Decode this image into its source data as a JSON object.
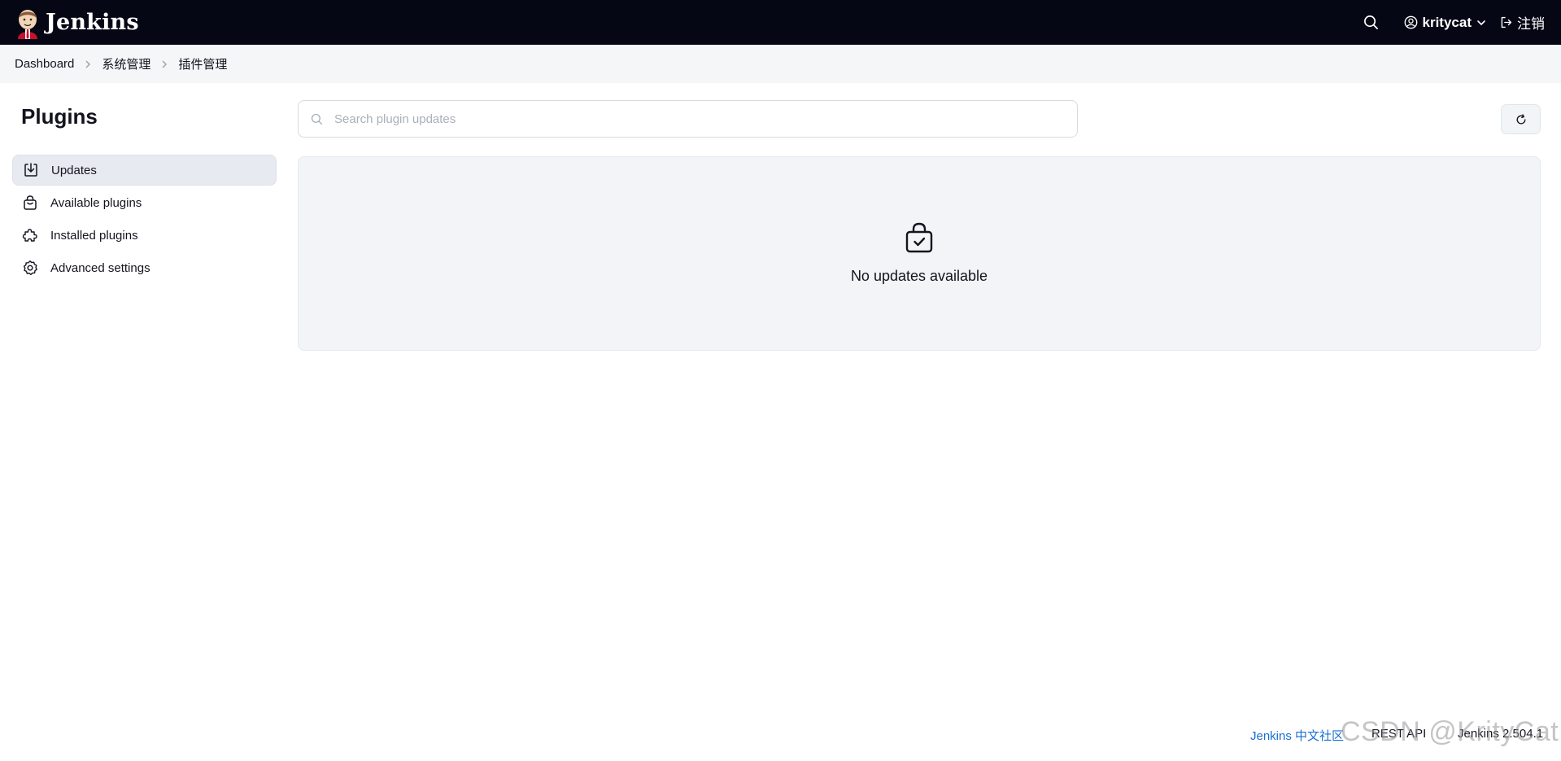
{
  "header": {
    "brand": "Jenkins",
    "user_name": "kritycat",
    "logout_label": "注销"
  },
  "breadcrumb": [
    "Dashboard",
    "系统管理",
    "插件管理"
  ],
  "sidebar": {
    "title": "Plugins",
    "items": [
      {
        "label": "Updates",
        "icon": "download-icon",
        "active": true
      },
      {
        "label": "Available plugins",
        "icon": "shopping-bag-icon",
        "active": false
      },
      {
        "label": "Installed plugins",
        "icon": "puzzle-icon",
        "active": false
      },
      {
        "label": "Advanced settings",
        "icon": "gear-icon",
        "active": false
      }
    ]
  },
  "search": {
    "placeholder": "Search plugin updates",
    "value": ""
  },
  "empty_state": {
    "icon": "shopping-bag-check-icon",
    "message": "No updates available"
  },
  "footer": {
    "community_link": "Jenkins 中文社区",
    "rest_api": "REST API",
    "version": "Jenkins 2.504.1"
  },
  "watermark": "CSDN @KrityCat",
  "colors": {
    "header_bg": "#050714",
    "breadcrumb_bg": "#f5f6f8",
    "active_item_bg": "#e7eaf0",
    "panel_bg": "#f2f4f7",
    "link": "#1a6fd1"
  }
}
